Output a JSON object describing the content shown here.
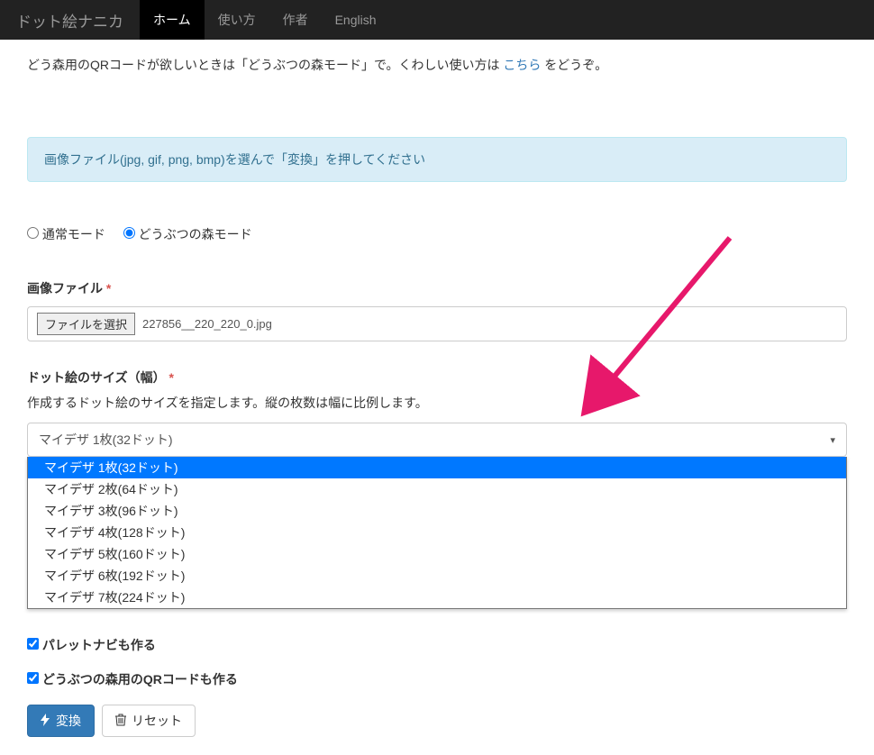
{
  "navbar": {
    "brand": "ドット絵ナニカ",
    "items": [
      "ホーム",
      "使い方",
      "作者",
      "English"
    ],
    "active_index": 0
  },
  "top_note": {
    "before": "どう森用のQRコードが欲しいときは「どうぶつの森モード」で。くわしい使い方は ",
    "link": "こちら",
    "after": " をどうぞ。"
  },
  "info_box": "画像ファイル(jpg, gif, png, bmp)を選んで「変換」を押してください",
  "mode": {
    "normal": "通常モード",
    "animal": "どうぶつの森モード"
  },
  "file": {
    "label": "画像ファイル",
    "button": "ファイルを選択",
    "name": "227856__220_220_0.jpg"
  },
  "size": {
    "label": "ドット絵のサイズ（幅）",
    "help": "作成するドット絵のサイズを指定します。縦の枚数は幅に比例します。",
    "selected": "マイデザ 1枚(32ドット)",
    "options": [
      "マイデザ 1枚(32ドット)",
      "マイデザ 2枚(64ドット)",
      "マイデザ 3枚(96ドット)",
      "マイデザ 4枚(128ドット)",
      "マイデザ 5枚(160ドット)",
      "マイデザ 6枚(192ドット)",
      "マイデザ 7枚(224ドット)"
    ],
    "selected_index": 0
  },
  "checkboxes": {
    "palette": "パレットナビも作る",
    "qr": "どうぶつの森用のQRコードも作る"
  },
  "buttons": {
    "convert": "変換",
    "reset": "リセット"
  }
}
